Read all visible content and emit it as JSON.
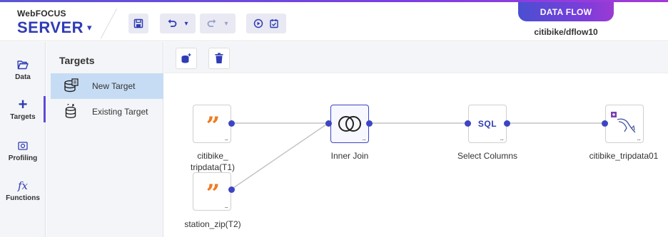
{
  "header": {
    "brand_small": "WebFOCUS",
    "brand_big": "SERVER",
    "mode_badge": "DATA FLOW",
    "flow_name": "citibike/dflow10"
  },
  "rail": {
    "items": [
      {
        "label": "Data",
        "icon": "folder-open-icon"
      },
      {
        "label": "Targets",
        "icon": "plus-icon"
      },
      {
        "label": "Profiling",
        "icon": "profiling-icon"
      },
      {
        "label": "Functions",
        "icon": "function-fx-icon"
      }
    ],
    "active": "Targets"
  },
  "panel": {
    "title": "Targets",
    "items": [
      {
        "label": "New Target",
        "icon": "new-target-database-icon",
        "selected": true
      },
      {
        "label": "Existing Target",
        "icon": "existing-target-database-icon",
        "selected": false
      }
    ]
  },
  "nodes": {
    "source1_label": "citibike_\ntripdata(T1)",
    "source2_label": "station_zip(T2)",
    "join_label": "Inner Join",
    "select_label": "Select Columns",
    "select_badge": "SQL",
    "target_label": "citibike_tripdata01",
    "more": "..."
  },
  "colors": {
    "accent": "#2f3cb4",
    "brand_gradient_start": "#4a4fd1",
    "brand_gradient_end": "#9b3ad3",
    "source_quote": "#f07a20",
    "selected_row": "#c6dcf4",
    "port": "#3d44c4"
  }
}
